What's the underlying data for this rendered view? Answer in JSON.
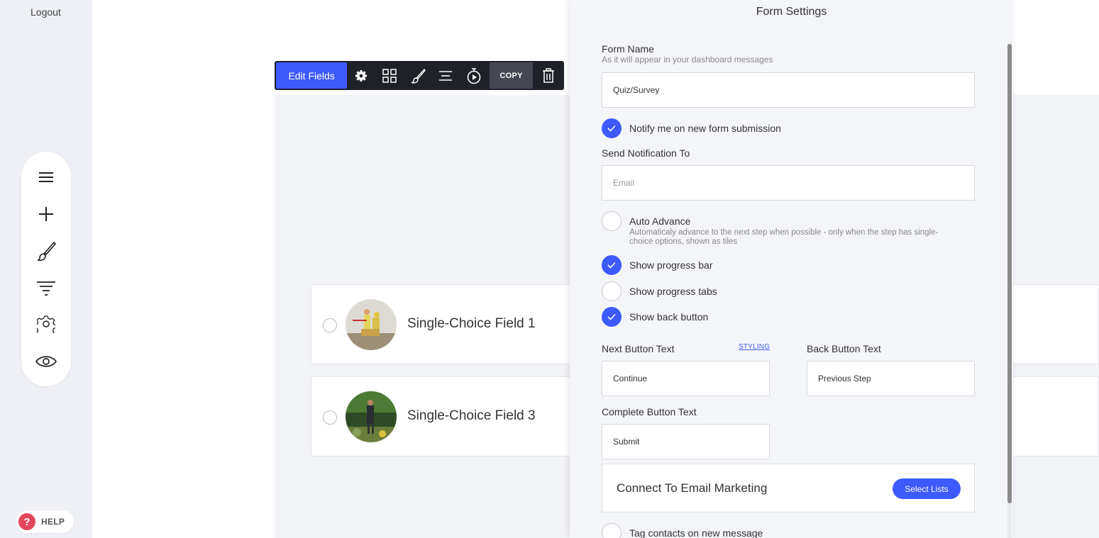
{
  "sidebar": {
    "logout_label": "Logout",
    "tools": [
      {
        "icon": "menu-icon"
      },
      {
        "icon": "plus-icon"
      },
      {
        "icon": "brush-icon"
      },
      {
        "icon": "filter-icon"
      },
      {
        "icon": "gear-icon"
      },
      {
        "icon": "eye-icon"
      }
    ],
    "help": {
      "icon": "question-icon",
      "glyph": "?",
      "label": "HELP",
      "color": "#e3475d"
    }
  },
  "toolbar": {
    "edit_fields_label": "Edit Fields",
    "copy_label": "COPY",
    "icons": [
      "gear-icon",
      "layout-icon",
      "brush-icon",
      "align-icon",
      "timer-icon",
      "trash-icon"
    ],
    "accent": "#3d5afe"
  },
  "choices": [
    {
      "label": "Single-Choice Field 1",
      "image": "workers-photo"
    },
    {
      "label": "Single-Choice Field 3",
      "image": "garden-photo"
    }
  ],
  "form_settings": {
    "title": "Form Settings",
    "form_name": {
      "label": "Form Name",
      "hint": "As it will appear in your dashboard messages",
      "value": "Quiz/Survey"
    },
    "notify": {
      "label": "Notify me on new form submission",
      "checked": true
    },
    "send_to": {
      "label": "Send Notification To",
      "placeholder": "Email",
      "value": ""
    },
    "auto_advance": {
      "label": "Auto Advance",
      "hint_line1": "Automaticaly advance to the next step when possible - only when the step has single-",
      "hint_line2": "choice options, shown as tiles",
      "checked": false
    },
    "show_progress_bar": {
      "label": "Show progress bar",
      "checked": true
    },
    "show_progress_tabs": {
      "label": "Show progress tabs",
      "checked": false
    },
    "show_back_button": {
      "label": "Show back button",
      "checked": true
    },
    "next_button": {
      "label": "Next Button Text",
      "value": "Continue",
      "styling_link": "STYLING"
    },
    "back_button": {
      "label": "Back Button Text",
      "value": "Previous Step"
    },
    "complete_button": {
      "label": "Complete Button Text",
      "value": "Submit"
    },
    "email_marketing": {
      "title": "Connect To Email Marketing",
      "button_label": "Select Lists"
    },
    "tag_contacts": {
      "label": "Tag contacts on new message",
      "checked": false
    }
  }
}
